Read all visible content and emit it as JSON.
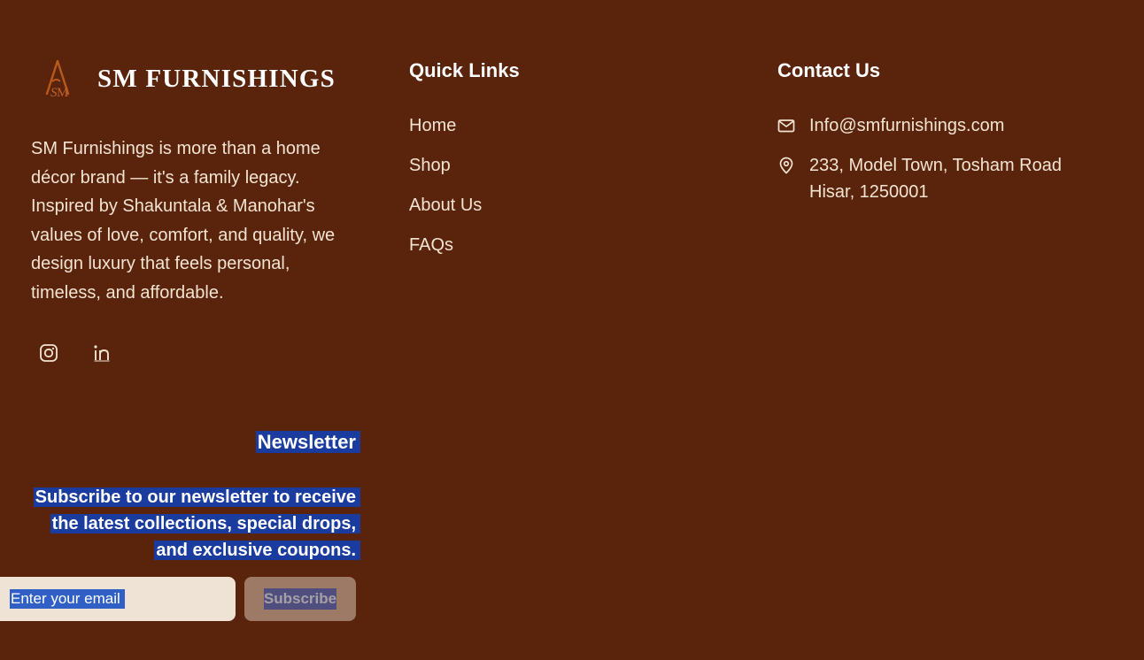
{
  "brand": {
    "logo_icon": "sm-monogram-logo-icon",
    "name": "SM FURNISHINGS",
    "description": "SM Furnishings is more than a home décor brand — it's a family legacy. Inspired by Shakuntala & Manohar's values of love, comfort, and quality, we design luxury that feels personal, timeless, and affordable."
  },
  "socials": [
    {
      "icon": "instagram-icon"
    },
    {
      "icon": "linkedin-icon"
    }
  ],
  "newsletter": {
    "title": "Newsletter",
    "lines": [
      "Subscribe to our newsletter to receive",
      "the latest collections, special drops,",
      "and exclusive coupons."
    ],
    "placeholder": "Enter your email",
    "button_label": "Subscribe"
  },
  "quick_links": {
    "title": "Quick Links",
    "items": [
      "Home",
      "Shop",
      "About Us",
      "FAQs"
    ]
  },
  "contact": {
    "title": "Contact Us",
    "email": "Info@smfurnishings.com",
    "address_line1": "233, Model Town, Tosham Road",
    "address_line2": "Hisar, 1250001"
  },
  "colors": {
    "background": "#5a230c",
    "text": "#f3e4d2",
    "logo_accent": "#b85a1c",
    "selection": "#1a3c9f"
  }
}
